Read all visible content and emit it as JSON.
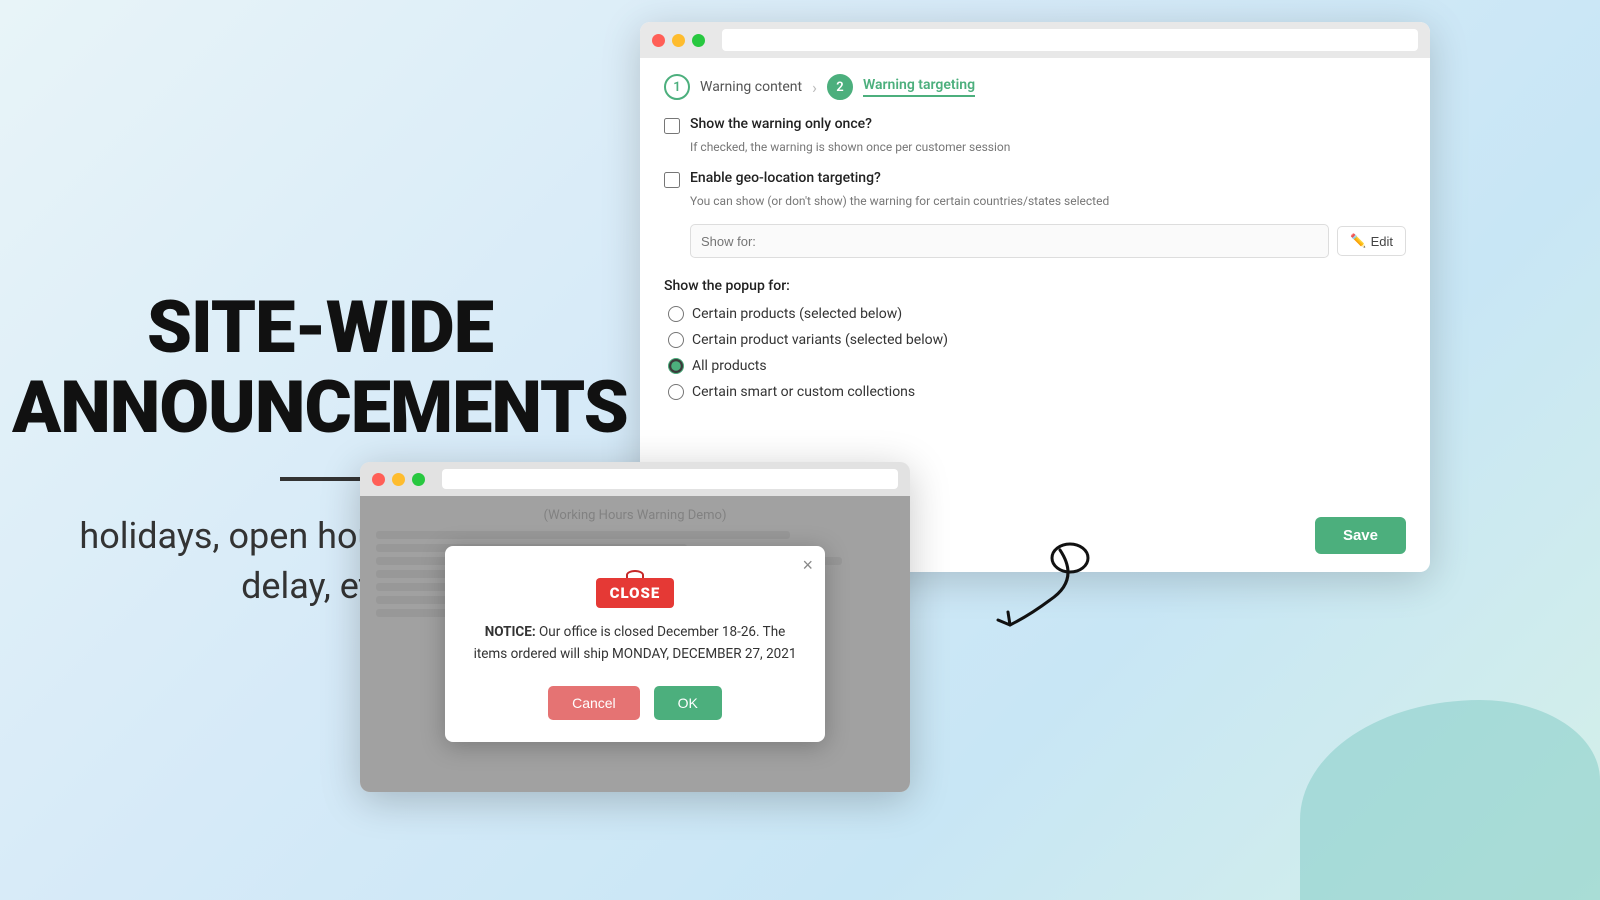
{
  "left": {
    "title_line1": "SITE-WIDE",
    "title_line2": "ANNOUNCEMENTS",
    "subtitle": "holidays, open hours, shipping delay, etc."
  },
  "browser_top": {
    "step1": {
      "number": "1",
      "label": "Warning content"
    },
    "step2": {
      "number": "2",
      "label": "Warning targeting",
      "active": true
    },
    "show_once_label": "Show the warning only once?",
    "show_once_desc": "If checked, the warning is shown once per customer session",
    "geo_label": "Enable geo-location targeting?",
    "geo_desc": "You can show (or don't show) the warning for certain countries/states selected",
    "show_for_placeholder": "Show for:",
    "edit_label": "Edit",
    "popup_section_label": "Show the popup for:",
    "radio_options": [
      "Certain products (selected below)",
      "Certain product variants (selected below)",
      "All products",
      "Certain smart or custom collections"
    ],
    "save_label": "Save"
  },
  "browser_bottom": {
    "address": "(Working Hours Warning Demo)",
    "modal": {
      "notice_prefix": "NOTICE:",
      "notice_text": "Our office is closed December 18-26. The items ordered will ship MONDAY, DECEMBER 27, 2021",
      "cancel_label": "Cancel",
      "ok_label": "OK"
    }
  }
}
